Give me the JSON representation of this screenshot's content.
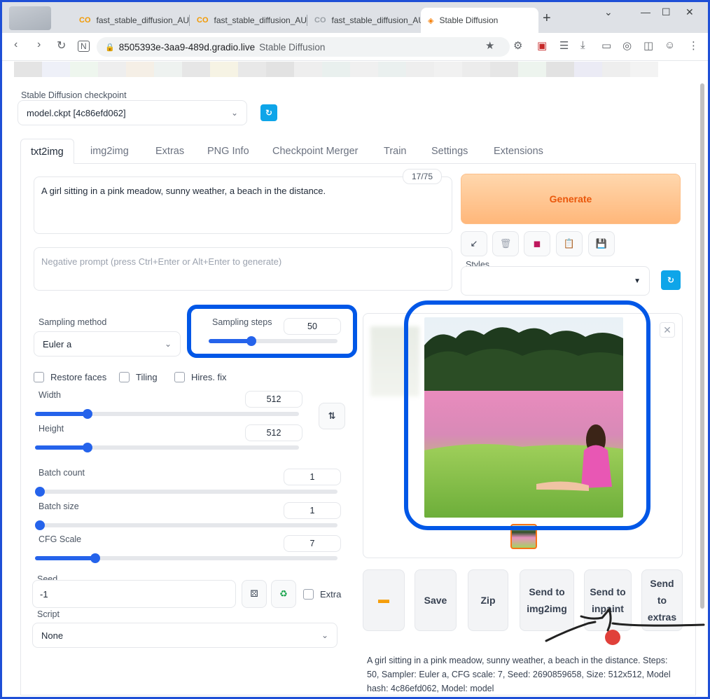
{
  "browser": {
    "tabs": [
      {
        "label": "fast_stable_diffusion_AU",
        "favicon": "CO"
      },
      {
        "label": "fast_stable_diffusion_AU",
        "favicon": "CO"
      },
      {
        "label": "fast_stable_diffusion_AU",
        "favicon": "CO"
      },
      {
        "label": "Stable Diffusion",
        "favicon": "◈"
      }
    ],
    "new_tab": "+",
    "url": "8505393e-3aa9-489d.gradio.live",
    "page_title": "Stable Diffusion"
  },
  "checkpoint": {
    "label": "Stable Diffusion checkpoint",
    "value": "model.ckpt [4c86efd062]"
  },
  "tabs": [
    "txt2img",
    "img2img",
    "Extras",
    "PNG Info",
    "Checkpoint Merger",
    "Train",
    "Settings",
    "Extensions"
  ],
  "prompt": {
    "value": "A girl sitting in a pink meadow, sunny weather, a beach in the distance.",
    "counter": "17/75",
    "negative_placeholder": "Negative prompt (press Ctrl+Enter or Alt+Enter to generate)"
  },
  "generate_label": "Generate",
  "styles_label": "Styles",
  "sampling": {
    "method_label": "Sampling method",
    "method_value": "Euler a",
    "steps_label": "Sampling steps",
    "steps_value": "50",
    "steps_fraction": 0.33
  },
  "checkboxes": {
    "restore_faces": "Restore faces",
    "tiling": "Tiling",
    "hires": "Hires. fix"
  },
  "width": {
    "label": "Width",
    "value": "512",
    "fraction": 0.2
  },
  "height": {
    "label": "Height",
    "value": "512",
    "fraction": 0.2
  },
  "batch_count": {
    "label": "Batch count",
    "value": "1",
    "fraction": 0.0
  },
  "batch_size": {
    "label": "Batch size",
    "value": "1",
    "fraction": 0.0
  },
  "cfg": {
    "label": "CFG Scale",
    "value": "7",
    "fraction": 0.2
  },
  "seed": {
    "label": "Seed",
    "value": "-1",
    "extra_label": "Extra"
  },
  "script": {
    "label": "Script",
    "value": "None"
  },
  "actions": {
    "save": "Save",
    "zip": "Zip",
    "send_img2img": "Send to img2img",
    "send_inpaint": "Send to inpaint",
    "send_extras": "Send to extras"
  },
  "info_text": "A girl sitting in a pink meadow, sunny weather, a beach in the distance. Steps: 50, Sampler: Euler a, CFG scale: 7, Seed: 2690859658, Size: 512x512, Model hash: 4c86efd062, Model: model",
  "colors": {
    "accent": "#2563eb",
    "highlight": "#0057e7",
    "generate": "#ffb77a"
  }
}
